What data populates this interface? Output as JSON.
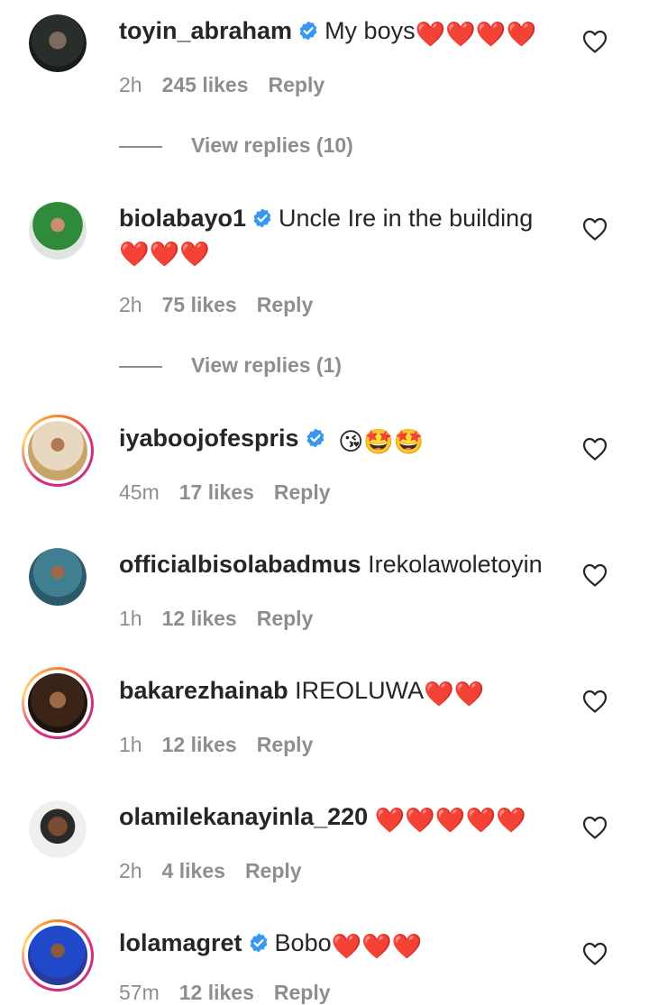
{
  "colors": {
    "verified": "#3897f0",
    "heart": "#e0242e",
    "meta": "#8e8e8e",
    "text": "#262626"
  },
  "comments": [
    {
      "username": "toyin_abraham",
      "verified": true,
      "text": "My boys",
      "emoji": "❤️❤️❤️❤️",
      "time": "2h",
      "likes": "245 likes",
      "reply": "Reply",
      "view_replies": "View replies (10)"
    },
    {
      "username": "biolabayo1",
      "verified": true,
      "text": "Uncle Ire in the building",
      "emoji": "❤️❤️❤️",
      "time": "2h",
      "likes": "75 likes",
      "reply": "Reply",
      "view_replies": "View replies (1)"
    },
    {
      "username": "iyaboojofespris",
      "verified": true,
      "text": "",
      "emoji": "😘🤩🤩",
      "time": "45m",
      "likes": "17 likes",
      "reply": "Reply"
    },
    {
      "username": "officialbisolabadmus",
      "verified": false,
      "text": "Irekolawoletoyin",
      "emoji": "",
      "time": "1h",
      "likes": "12 likes",
      "reply": "Reply"
    },
    {
      "username": "bakarezhainab",
      "verified": false,
      "text": "IREOLUWA",
      "emoji": "❤️❤️",
      "time": "1h",
      "likes": "12 likes",
      "reply": "Reply"
    },
    {
      "username": "olamilekanayinla_220",
      "verified": false,
      "text": "",
      "emoji": "❤️❤️❤️❤️❤️",
      "time": "2h",
      "likes": "4 likes",
      "reply": "Reply"
    },
    {
      "username": "lolamagret",
      "verified": true,
      "text": "Bobo",
      "emoji": "❤️❤️❤️",
      "time": "57m",
      "likes": "12 likes",
      "reply": "Reply"
    }
  ]
}
